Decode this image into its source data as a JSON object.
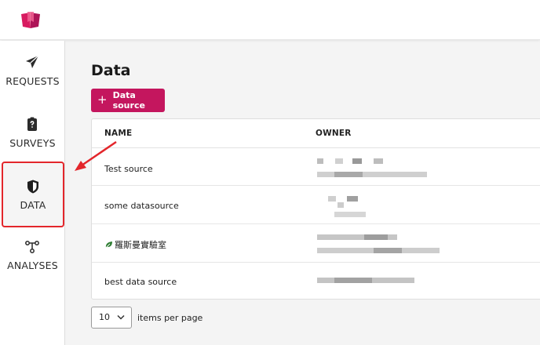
{
  "nav": {
    "requests": "REQUESTS",
    "surveys": "SURVEYS",
    "data": "DATA",
    "analyses": "ANALYSES"
  },
  "page": {
    "title": "Data",
    "add_button": "Data source"
  },
  "table": {
    "columns": [
      "NAME",
      "OWNER"
    ],
    "rows": [
      {
        "name": "Test source"
      },
      {
        "name": "some datasource"
      },
      {
        "name": "羅斯曼實驗室"
      },
      {
        "name": "best data source"
      }
    ]
  },
  "pagination": {
    "per_page_value": "10",
    "per_page_label": "items per page"
  },
  "colors": {
    "accent": "#c4165e",
    "highlight": "#e3262b"
  }
}
